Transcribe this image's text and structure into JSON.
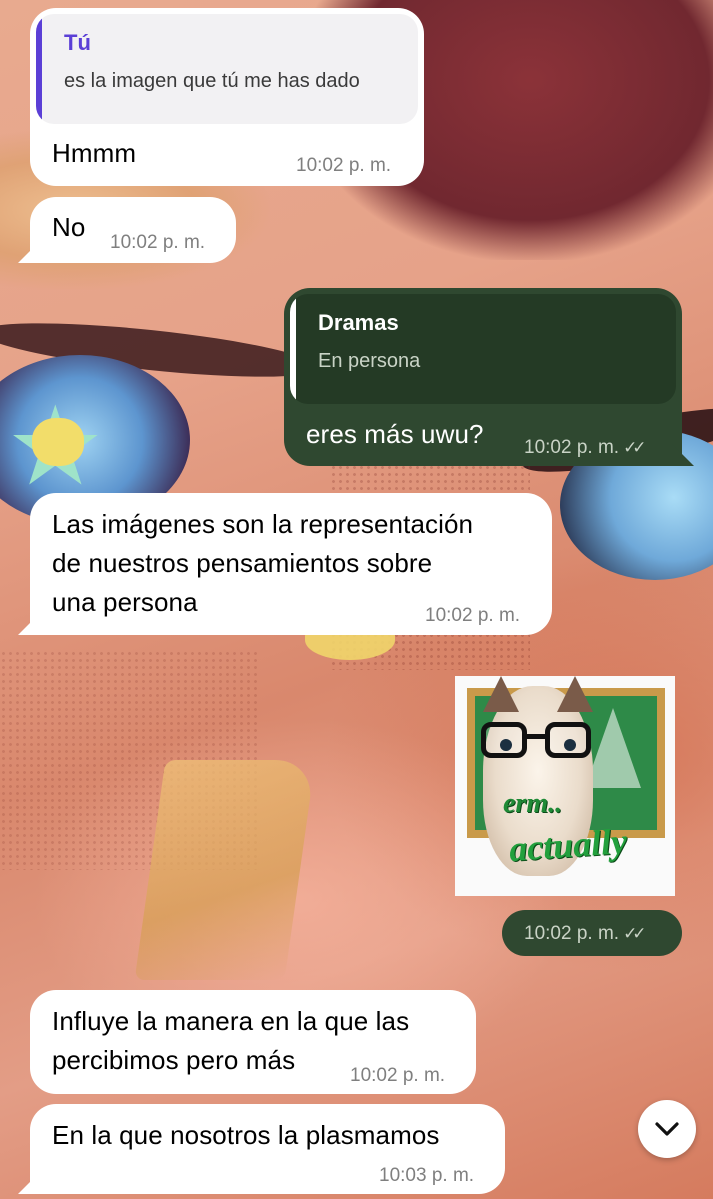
{
  "messages": [
    {
      "direction": "incoming",
      "quote": {
        "author": "Tú",
        "text": "es la imagen que tú me has dado"
      },
      "text": "Hmmm",
      "time": "10:02 p. m."
    },
    {
      "direction": "incoming",
      "text": "No",
      "time": "10:02 p. m."
    },
    {
      "direction": "outgoing",
      "quote": {
        "author": "Dramas",
        "text": "En persona"
      },
      "text": "eres más uwu?",
      "time": "10:02 p. m.",
      "status": "read"
    },
    {
      "direction": "incoming",
      "text_lines": [
        "Las imágenes son la representación",
        "de nuestros pensamientos sobre",
        "una persona"
      ],
      "time": "10:02 p. m."
    },
    {
      "direction": "outgoing",
      "sticker": {
        "icon": "cat-with-glasses-sticker",
        "lines": [
          "erm..",
          "actually"
        ]
      },
      "time": "10:02 p. m.",
      "status": "read"
    },
    {
      "direction": "incoming",
      "text_lines": [
        "Influye la manera en la que las",
        "percibimos pero más"
      ],
      "time": "10:02 p. m."
    },
    {
      "direction": "incoming",
      "text": "En la que nosotros la plasmamos",
      "time": "10:03 p. m."
    }
  ],
  "read_receipt_glyph": "✓✓",
  "scroll_button": {
    "icon": "chevron-down-icon"
  },
  "colors": {
    "incoming_bubble": "#ffffff",
    "outgoing_bubble": "#2f4830",
    "quote_accent": "#5b3fd6"
  }
}
